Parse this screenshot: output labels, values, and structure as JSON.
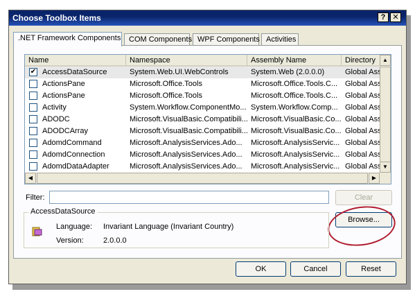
{
  "window": {
    "title": "Choose Toolbox Items"
  },
  "titlebar": {
    "help_label": "?",
    "close_label": "✕"
  },
  "tabs": [
    {
      "label": ".NET Framework Components"
    },
    {
      "label": "COM Components"
    },
    {
      "label": "WPF Components"
    },
    {
      "label": "Activities"
    }
  ],
  "list": {
    "columns": [
      "Name",
      "Namespace",
      "Assembly Name",
      "Directory"
    ],
    "rows": [
      {
        "checked": true,
        "name": "AccessDataSource",
        "ns": "System.Web.UI.WebControls",
        "asm": "System.Web (2.0.0.0)",
        "dir": "Global Ass"
      },
      {
        "checked": false,
        "name": "ActionsPane",
        "ns": "Microsoft.Office.Tools",
        "asm": "Microsoft.Office.Tools.C...",
        "dir": "Global Ass"
      },
      {
        "checked": false,
        "name": "ActionsPane",
        "ns": "Microsoft.Office.Tools",
        "asm": "Microsoft.Office.Tools.C...",
        "dir": "Global Ass"
      },
      {
        "checked": false,
        "name": "Activity",
        "ns": "System.Workflow.ComponentMo...",
        "asm": "System.Workflow.Comp...",
        "dir": "Global Ass"
      },
      {
        "checked": false,
        "name": "ADODC",
        "ns": "Microsoft.VisualBasic.Compatibili...",
        "asm": "Microsoft.VisualBasic.Co...",
        "dir": "Global Ass"
      },
      {
        "checked": false,
        "name": "ADODCArray",
        "ns": "Microsoft.VisualBasic.Compatibili...",
        "asm": "Microsoft.VisualBasic.Co...",
        "dir": "Global Ass"
      },
      {
        "checked": false,
        "name": "AdomdCommand",
        "ns": "Microsoft.AnalysisServices.Ado...",
        "asm": "Microsoft.AnalysisServic...",
        "dir": "Global Ass"
      },
      {
        "checked": false,
        "name": "AdomdConnection",
        "ns": "Microsoft.AnalysisServices.Ado...",
        "asm": "Microsoft.AnalysisServic...",
        "dir": "Global Ass"
      },
      {
        "checked": false,
        "name": "AdomdDataAdapter",
        "ns": "Microsoft.AnalysisServices.Ado...",
        "asm": "Microsoft.AnalysisServic...",
        "dir": "Global Ass"
      }
    ]
  },
  "filter": {
    "label": "Filter:",
    "value": ""
  },
  "buttons": {
    "clear": "Clear",
    "browse": "Browse...",
    "ok": "OK",
    "cancel": "Cancel",
    "reset": "Reset"
  },
  "details": {
    "group_title": "AccessDataSource",
    "language_label": "Language:",
    "language_value": "Invariant Language (Invariant Country)",
    "version_label": "Version:",
    "version_value": "2.0.0.0"
  },
  "colors": {
    "annotation_circle": "#b01c2e",
    "titlebar": "#0a246a"
  }
}
